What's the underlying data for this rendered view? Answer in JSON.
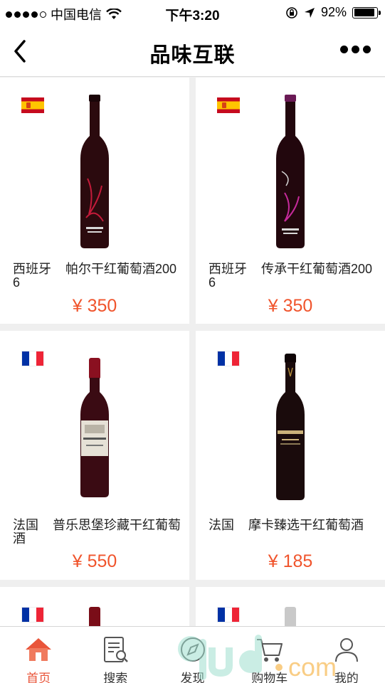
{
  "status": {
    "carrier": "中国电信",
    "time": "下午3:20",
    "battery": "92%",
    "battery_level": 0.92
  },
  "nav": {
    "title": "品味互联"
  },
  "products": [
    {
      "country": "西班牙",
      "name": "帕尔干红葡萄酒2006",
      "price": "¥ 350",
      "flag": "spain-flag-icon",
      "bottle_color": "#2b0a0e",
      "label_color": "#c31b3a"
    },
    {
      "country": "西班牙",
      "name": "传承干红葡萄酒2006",
      "price": "¥ 350",
      "flag": "spain-flag-icon",
      "bottle_color": "#22070d",
      "label_color": "#c62a9b"
    },
    {
      "country": "法国",
      "name": "普乐思堡珍藏干红葡萄酒",
      "price": "¥ 550",
      "flag": "france-flag-icon",
      "bottle_color": "#3a0b13",
      "label_color": "#e6e1d6"
    },
    {
      "country": "法国",
      "name": "摩卡臻选干红葡萄酒",
      "price": "¥ 185",
      "flag": "france-flag-icon",
      "bottle_color": "#1a0b0c",
      "label_color": "#1a0b0c"
    },
    {
      "country": "",
      "name": "",
      "price": "",
      "flag": "france-flag-icon",
      "bottle_color": "#5a0d14",
      "label_color": "#5a0d14"
    },
    {
      "country": "",
      "name": "",
      "price": "",
      "flag": "france-flag-icon",
      "bottle_color": "#c9c9c9",
      "label_color": "#c9c9c9"
    }
  ],
  "tabs": [
    {
      "label": "首页",
      "icon": "home-icon",
      "active": true
    },
    {
      "label": "搜索",
      "icon": "search-doc-icon",
      "active": false
    },
    {
      "label": "发现",
      "icon": "discover-icon",
      "active": false
    },
    {
      "label": "购物车",
      "icon": "cart-icon",
      "active": false
    },
    {
      "label": "我的",
      "icon": "user-icon",
      "active": false
    }
  ],
  "colors": {
    "accent": "#e9553a",
    "price": "#f0542c"
  }
}
